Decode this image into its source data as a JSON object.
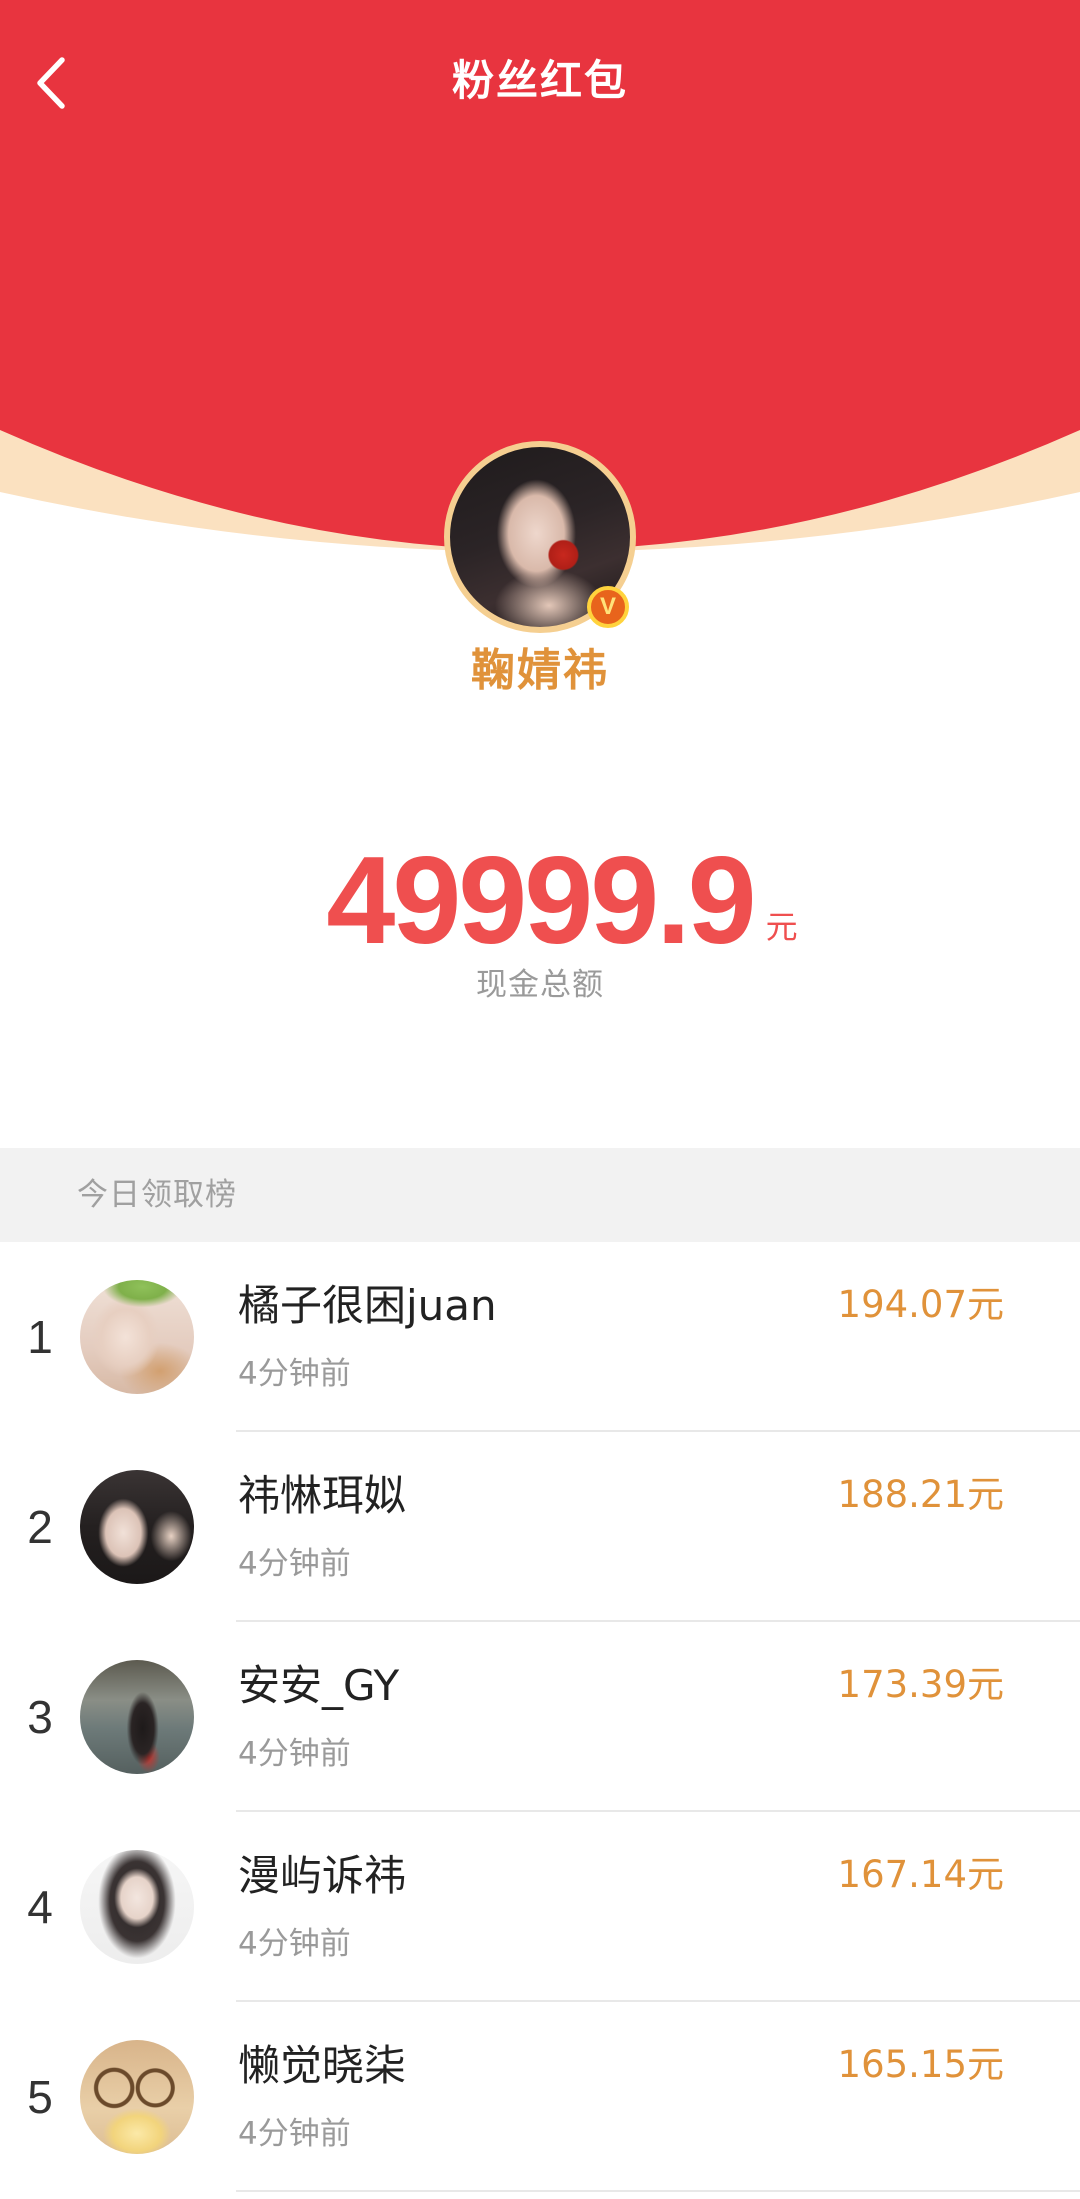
{
  "header": {
    "title": "粉丝红包",
    "back_icon": "back-arrow-icon"
  },
  "creator": {
    "name": "鞠婧祎",
    "avatar_icon": "creator-avatar",
    "verified_badge": "V"
  },
  "total": {
    "amount": "49999.9",
    "unit": "元",
    "label": "现金总额"
  },
  "ranking": {
    "title": "今日领取榜",
    "items": [
      {
        "rank": "1",
        "name": "橘子很困juan",
        "time": "4分钟前",
        "amount": "194.07元"
      },
      {
        "rank": "2",
        "name": "祎惏珥姒",
        "time": "4分钟前",
        "amount": "188.21元"
      },
      {
        "rank": "3",
        "name": "安安_GY",
        "time": "4分钟前",
        "amount": "173.39元"
      },
      {
        "rank": "4",
        "name": "漫屿诉祎",
        "time": "4分钟前",
        "amount": "167.14元"
      },
      {
        "rank": "5",
        "name": "懒觉晓柒",
        "time": "4分钟前",
        "amount": "165.15元"
      }
    ]
  },
  "colors": {
    "header_red": "#e8343f",
    "cream": "#fbe1c0",
    "gold": "#e0923a",
    "amount_red": "#ef4f4f"
  }
}
